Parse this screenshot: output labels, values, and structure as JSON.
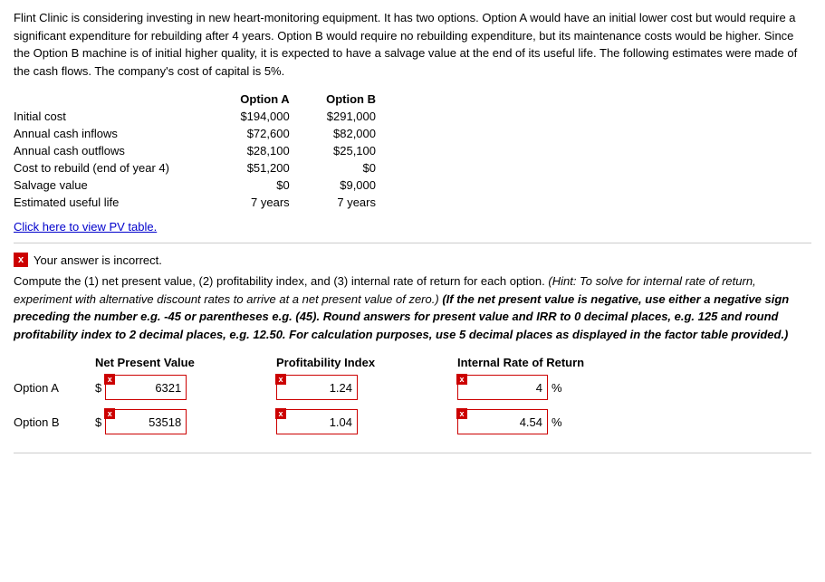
{
  "problem": {
    "text": "Flint Clinic is considering investing in new heart-monitoring equipment. It has two options. Option A would have an initial lower cost but would require a significant expenditure for rebuilding after 4 years. Option B would require no rebuilding expenditure, but its maintenance costs would be higher. Since the Option B machine is of initial higher quality, it is expected to have a salvage value at the end of its useful life. The following estimates were made of the cash flows. The company's cost of capital is 5%.",
    "table": {
      "headers": [
        "",
        "Option A",
        "Option B"
      ],
      "rows": [
        [
          "Initial cost",
          "$194,000",
          "$291,000"
        ],
        [
          "Annual cash inflows",
          "$72,600",
          "$82,000"
        ],
        [
          "Annual cash outflows",
          "$28,100",
          "$25,100"
        ],
        [
          "Cost to rebuild (end of year 4)",
          "$51,200",
          "$0"
        ],
        [
          "Salvage value",
          "$0",
          "$9,000"
        ],
        [
          "Estimated useful life",
          "7 years",
          "7 years"
        ]
      ]
    },
    "pv_link": "Click here to view PV table."
  },
  "feedback": {
    "incorrect_label": "Your answer is incorrect.",
    "x_symbol": "x"
  },
  "instruction": {
    "text1": "Compute the (1) net present value, (2) profitability index, and (3) internal rate of return for each option. (",
    "hint": "Hint: To solve for internal rate of return, experiment with alternative discount rates to arrive at a net present value of zero.",
    "text2": ") (",
    "bold_part": "If the net present value is negative, use either a negative sign preceding the number e.g. -45 or parentheses e.g. (45). Round answers for present value and IRR to 0 decimal places, e.g. 125 and round profitability index to 2 decimal places, e.g. 12.50. For calculation purposes, use 5 decimal places as displayed in the factor table provided.",
    "text3": ")"
  },
  "answers_section": {
    "headers": {
      "col0": "",
      "col1": "Net Present Value",
      "col2": "Profitability Index",
      "col3": "Internal Rate of Return"
    },
    "rows": [
      {
        "label": "Option A",
        "npv": "6321",
        "pi": "1.24",
        "irr": "4",
        "irr_has_value": true
      },
      {
        "label": "Option B",
        "npv": "53518",
        "pi": "1.04",
        "irr": "4.54",
        "irr_has_value": true
      }
    ],
    "percent_symbol": "%",
    "dollar_symbol": "$"
  }
}
